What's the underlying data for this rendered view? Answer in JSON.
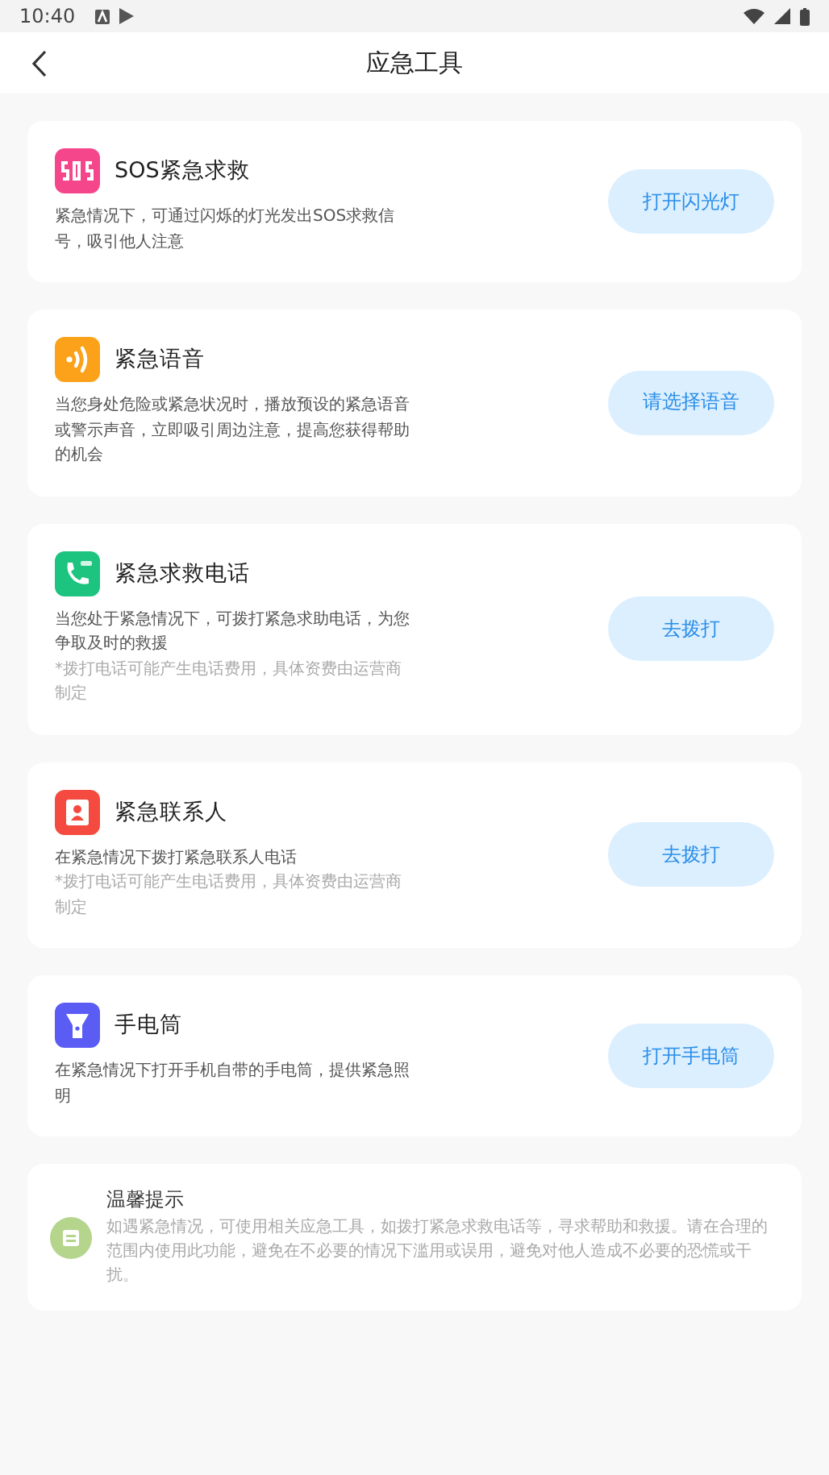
{
  "status_bar": {
    "time": "10:40"
  },
  "header": {
    "title": "应急工具"
  },
  "tools": [
    {
      "kind": "sos",
      "title": "SOS紧急求救",
      "description": "紧急情况下，可通过闪烁的灯光发出SOS求救信号，吸引他人注意",
      "button": "打开闪光灯"
    },
    {
      "kind": "voice",
      "title": "紧急语音",
      "description": "当您身处危险或紧急状况时，播放预设的紧急语音或警示声音，立即吸引周边注意，提高您获得帮助的机会",
      "button": "请选择语音"
    },
    {
      "kind": "phone",
      "title": "紧急求救电话",
      "description": "当您处于紧急情况下，可拨打紧急求助电话，为您争取及时的救援",
      "note": "*拨打电话可能产生电话费用，具体资费由运营商制定",
      "button": "去拨打"
    },
    {
      "kind": "contact",
      "title": "紧急联系人",
      "description": "在紧急情况下拨打紧急联系人电话",
      "note": "*拨打电话可能产生电话费用，具体资费由运营商制定",
      "button": "去拨打"
    },
    {
      "kind": "flashlight",
      "title": "手电筒",
      "description": "在紧急情况下打开手机自带的手电筒，提供紧急照明",
      "button": "打开手电筒"
    }
  ],
  "tip": {
    "title": "温馨提示",
    "text": "如遇紧急情况，可使用相关应急工具，如拨打紧急求救电话等，寻求帮助和救援。请在合理的范围内使用此功能，避免在不必要的情况下滥用或误用，避免对他人造成不必要的恐慌或干扰。"
  }
}
